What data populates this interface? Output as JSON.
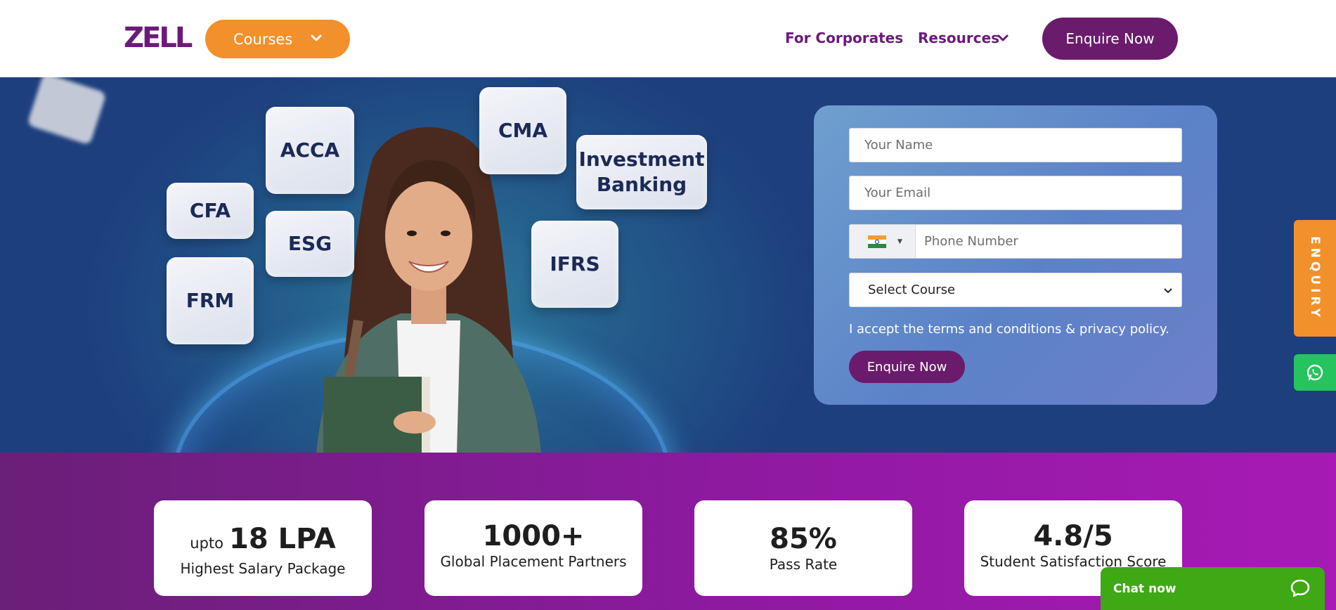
{
  "header": {
    "logo": "ZELL",
    "courses_label": "Courses",
    "nav": {
      "corporates": "For Corporates",
      "resources": "Resources"
    },
    "enquire_label": "Enquire Now"
  },
  "hero": {
    "tiles": {
      "acca": "ACCA",
      "cma": "CMA",
      "investment": "Investment Banking",
      "cfa": "CFA",
      "esg": "ESG",
      "ifrs": "IFRS",
      "frm": "FRM"
    }
  },
  "form": {
    "name_placeholder": "Your Name",
    "email_placeholder": "Your Email",
    "phone_placeholder": "Phone Number",
    "course_selected": "Select Course",
    "terms": "I accept the terms and conditions & privacy policy.",
    "submit_label": "Enquire Now"
  },
  "stats": [
    {
      "prefix": "upto",
      "value": "18 LPA",
      "label": "Highest Salary Package"
    },
    {
      "value": "1000+",
      "label": "Global Placement Partners"
    },
    {
      "value": "85%",
      "label": "Pass Rate"
    },
    {
      "value": "4.8/5",
      "label": "Student Satisfaction Score"
    }
  ],
  "side": {
    "enquiry": "ENQUIRY"
  },
  "chat": {
    "label": "Chat now"
  },
  "colors": {
    "brand_purple": "#6a1b6b",
    "accent_orange": "#f2902b",
    "chat_green": "#3fa815",
    "whatsapp_green": "#25c45e"
  }
}
